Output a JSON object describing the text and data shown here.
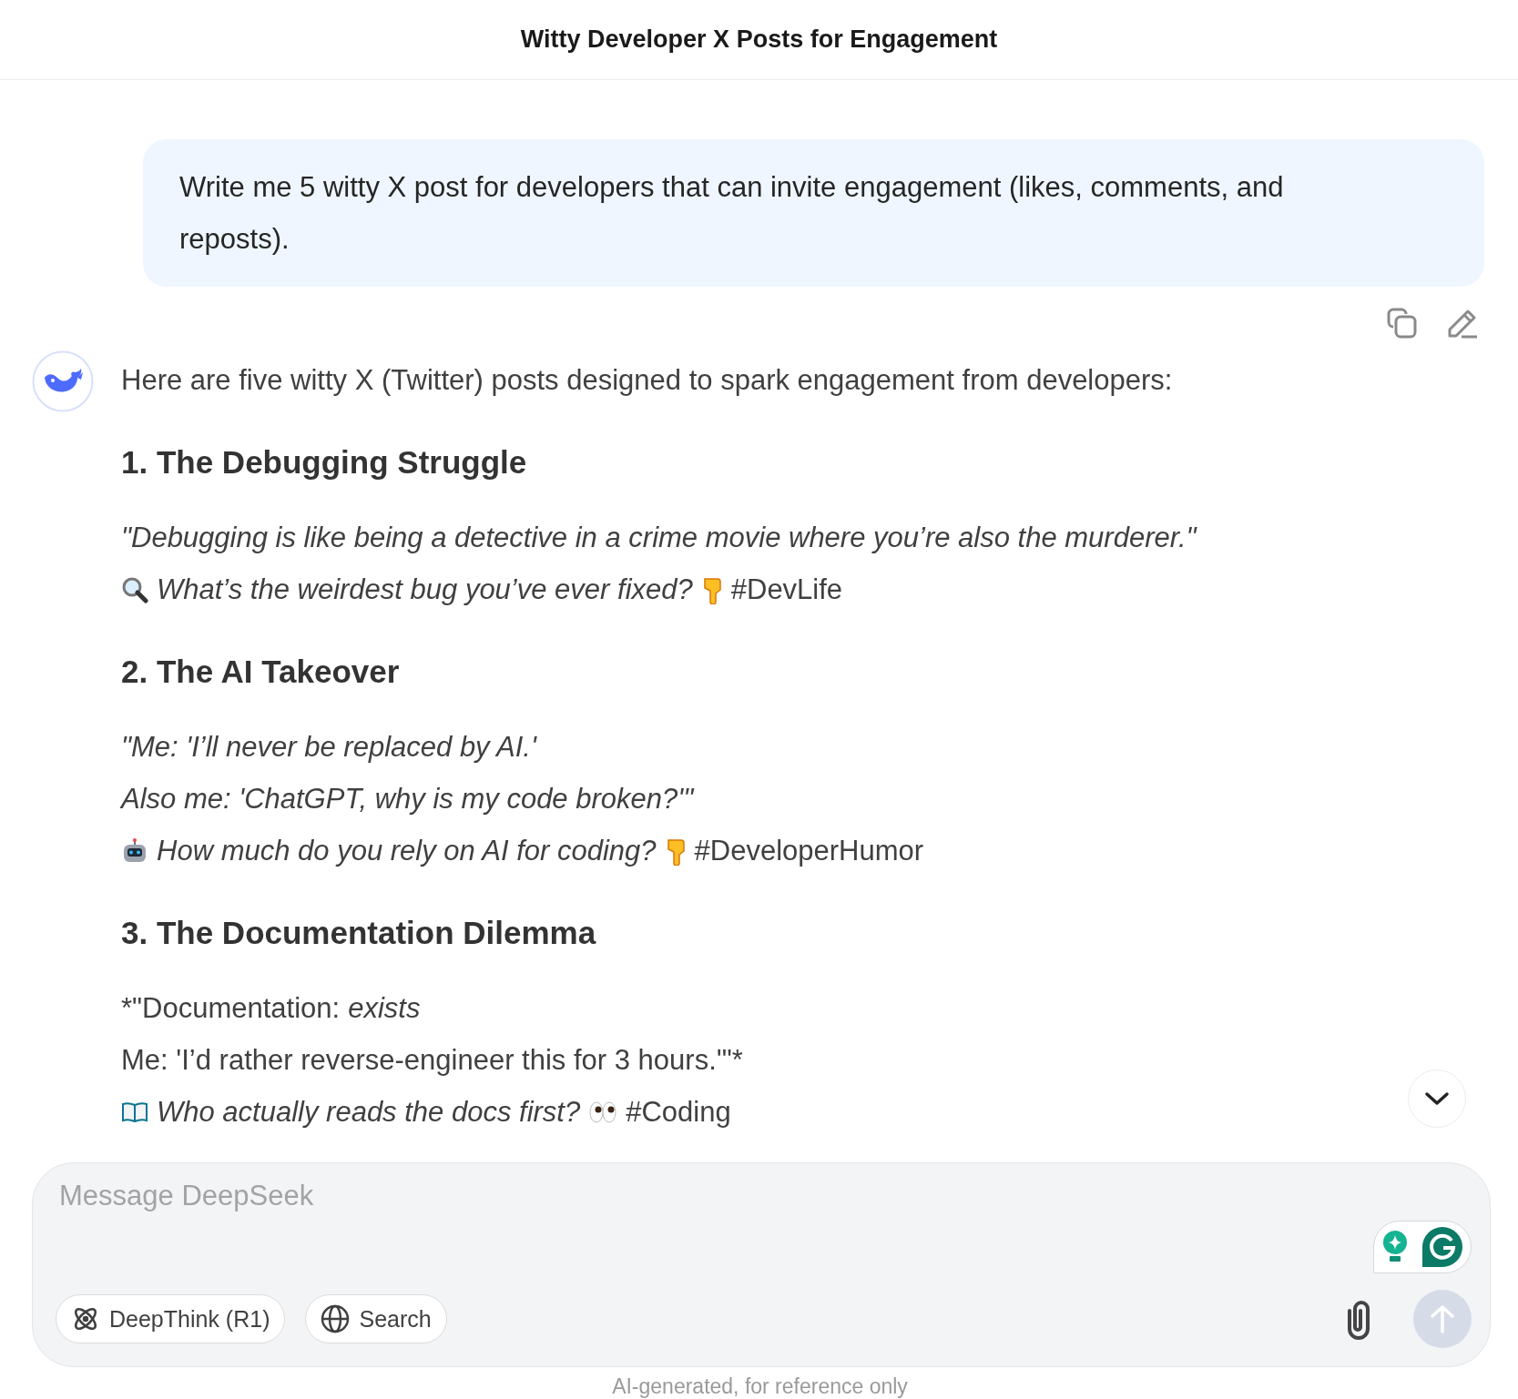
{
  "title": "Witty Developer X Posts for Engagement",
  "user_message": {
    "text": "Write me 5 witty X post for developers that can invite engagement (likes, comments, and reposts)."
  },
  "assistant": {
    "intro": "Here are five witty X (Twitter) posts designed to spark engagement from developers:",
    "sections": [
      {
        "heading": "1. The Debugging Struggle",
        "lines": [
          [
            {
              "kind": "text",
              "italic": true,
              "text": "\"Debugging is like being a detective in a crime movie where you’re also the murderer.\""
            }
          ],
          [
            {
              "kind": "icon"
            },
            {
              "kind": "text",
              "italic": true,
              "text": "What’s the weirdest bug you’ve ever fixed?"
            },
            {
              "kind": "icon"
            },
            {
              "kind": "text",
              "italic": false,
              "text": "#DevLife"
            }
          ]
        ]
      },
      {
        "heading": "2. The AI Takeover",
        "lines": [
          [
            {
              "kind": "text",
              "italic": true,
              "text": "\"Me: 'I’ll never be replaced by AI.'"
            }
          ],
          [
            {
              "kind": "text",
              "italic": true,
              "text": "Also me: 'ChatGPT, why is my code broken?'\""
            }
          ],
          [
            {
              "kind": "icon"
            },
            {
              "kind": "text",
              "italic": true,
              "text": "How much do you rely on AI for coding?"
            },
            {
              "kind": "icon"
            },
            {
              "kind": "text",
              "italic": false,
              "text": "#DeveloperHumor"
            }
          ]
        ]
      },
      {
        "heading": "3. The Documentation Dilemma",
        "lines": [
          [
            {
              "kind": "text",
              "italic": false,
              "text": "*\"Documentation:"
            },
            {
              "kind": "text",
              "italic": true,
              "text": "exists"
            }
          ],
          [
            {
              "kind": "text",
              "italic": false,
              "text": "Me: 'I’d rather reverse-engineer this for 3 hours.'\"*"
            }
          ],
          [
            {
              "kind": "icon"
            },
            {
              "kind": "text",
              "italic": true,
              "text": "Who actually reads the docs first?"
            },
            {
              "kind": "icon"
            },
            {
              "kind": "text",
              "italic": false,
              "text": "#Coding"
            }
          ]
        ]
      }
    ]
  },
  "composer": {
    "placeholder": "Message DeepSeek",
    "buttons": [
      {
        "label": "DeepThink (R1)",
        "selected": false
      },
      {
        "label": "Search",
        "selected": false
      }
    ]
  },
  "footer": "AI-generated, for reference only"
}
